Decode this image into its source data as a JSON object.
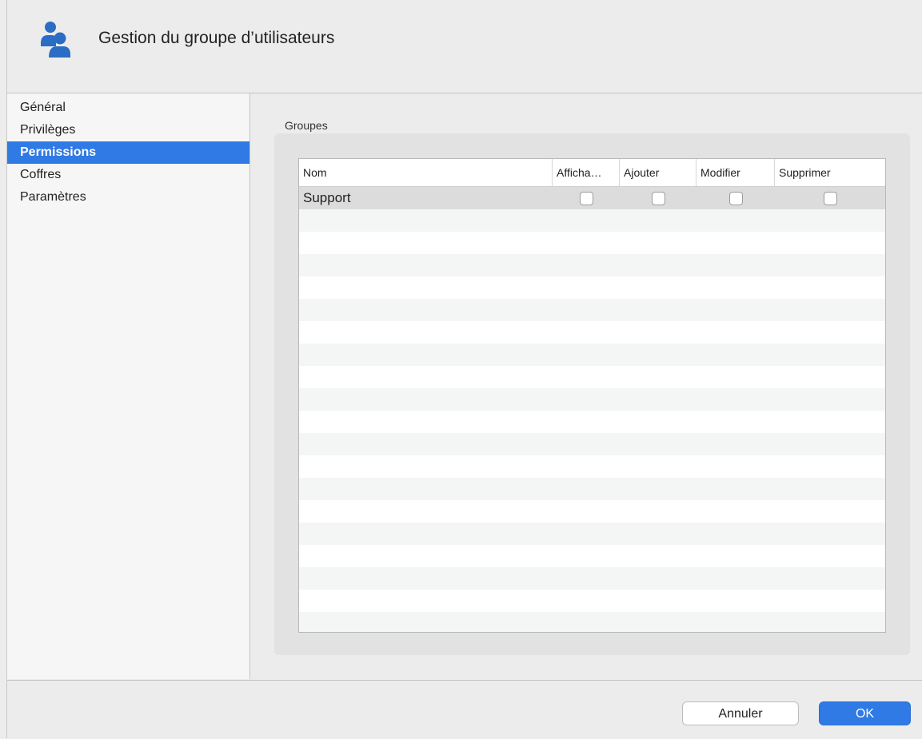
{
  "header": {
    "title": "Gestion du groupe d’utilisateurs",
    "icon": "users-icon"
  },
  "sidebar": {
    "items": [
      {
        "label": "Général",
        "selected": false
      },
      {
        "label": "Privilèges",
        "selected": false
      },
      {
        "label": "Permissions",
        "selected": true
      },
      {
        "label": "Coffres",
        "selected": false
      },
      {
        "label": "Paramètres",
        "selected": false
      }
    ]
  },
  "main": {
    "group_label": "Groupes",
    "columns": [
      "Nom",
      "Afficha…",
      "Ajouter",
      "Modifier",
      "Supprimer"
    ],
    "rows": [
      {
        "name": "Support",
        "afficher": false,
        "ajouter": false,
        "modifier": false,
        "supprimer": false
      }
    ]
  },
  "footer": {
    "cancel_label": "Annuler",
    "ok_label": "OK"
  },
  "colors": {
    "accent": "#2f7ae5",
    "icon": "#2b6cc4"
  }
}
